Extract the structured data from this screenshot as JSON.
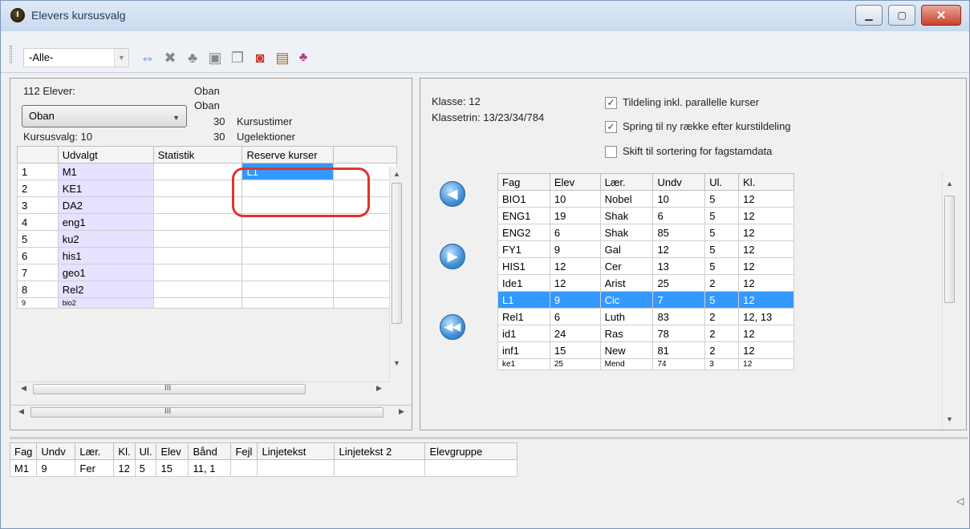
{
  "window": {
    "title": "Elevers kursusvalg",
    "minimize": "▁",
    "maximize": "▢",
    "close": "✕"
  },
  "toolbar": {
    "filter_value": "-Alle-",
    "icons": [
      "swap-icon",
      "delete-icon",
      "hierarchy-icon",
      "lock-icon",
      "copy-icon",
      "magnify-remove-icon",
      "multi-copy-icon",
      "users-icon"
    ]
  },
  "left_panel": {
    "student_count": "112 Elever:",
    "class_name_1": "Oban",
    "class_name_2": "Oban",
    "student_select": "Oban",
    "hours_value": "30",
    "hours_label": "Kursustimer",
    "lessons_value": "30",
    "lessons_label": "Ugelektioner",
    "course_choice": "Kursusvalg: 10",
    "columns": [
      "",
      "Udvalgt",
      "Statistik",
      "Reserve kurser"
    ],
    "rows": [
      {
        "n": "1",
        "udvalgt": "M1",
        "statistik": "",
        "reserve": "L1"
      },
      {
        "n": "2",
        "udvalgt": "KE1",
        "statistik": "",
        "reserve": ""
      },
      {
        "n": "3",
        "udvalgt": "DA2",
        "statistik": "",
        "reserve": ""
      },
      {
        "n": "4",
        "udvalgt": "eng1",
        "statistik": "",
        "reserve": ""
      },
      {
        "n": "5",
        "udvalgt": "ku2",
        "statistik": "",
        "reserve": ""
      },
      {
        "n": "6",
        "udvalgt": "his1",
        "statistik": "",
        "reserve": ""
      },
      {
        "n": "7",
        "udvalgt": "geo1",
        "statistik": "",
        "reserve": ""
      },
      {
        "n": "8",
        "udvalgt": "Rel2",
        "statistik": "",
        "reserve": ""
      },
      {
        "n": "9",
        "udvalgt": "bio2",
        "statistik": "",
        "reserve": ""
      }
    ],
    "hscroll_marker": "III"
  },
  "right_panel": {
    "class_label": "Klasse: 12",
    "class_level": "Klassetrin: 13/23/34/784",
    "options": [
      {
        "label": "Tildeling inkl. parallelle kurser",
        "checked": true
      },
      {
        "label": "Spring til ny række efter kurstildeling",
        "checked": true
      },
      {
        "label": "Skift til sortering for fagstamdata",
        "checked": false
      }
    ],
    "columns": [
      "Fag",
      "Elev",
      "Lær.",
      "Undv",
      "Ul.",
      "Kl."
    ],
    "rows": [
      [
        "BIO1",
        "10",
        "Nobel",
        "10",
        "5",
        "12"
      ],
      [
        "ENG1",
        "19",
        "Shak",
        "6",
        "5",
        "12"
      ],
      [
        "ENG2",
        "6",
        "Shak",
        "85",
        "5",
        "12"
      ],
      [
        "FY1",
        "9",
        "Gal",
        "12",
        "5",
        "12"
      ],
      [
        "HIS1",
        "12",
        "Cer",
        "13",
        "5",
        "12"
      ],
      [
        "Ide1",
        "12",
        "Arist",
        "25",
        "2",
        "12"
      ],
      [
        "L1",
        "9",
        "Cic",
        "7",
        "5",
        "12"
      ],
      [
        "Rel1",
        "6",
        "Luth",
        "83",
        "2",
        "12, 13"
      ],
      [
        "id1",
        "24",
        "Ras",
        "78",
        "2",
        "12"
      ],
      [
        "inf1",
        "15",
        "New",
        "81",
        "2",
        "12"
      ],
      [
        "ke1",
        "25",
        "Mend",
        "74",
        "3",
        "12"
      ]
    ],
    "selected_row": 6
  },
  "bottom_panel": {
    "columns": [
      "Fag",
      "Undv",
      "Lær.",
      "Kl.",
      "Ul.",
      "Elev",
      "Bånd",
      "Fejl",
      "Linjetekst",
      "Linjetekst 2",
      "Elevgruppe"
    ],
    "row": [
      "M1",
      "9",
      "Fer",
      "12",
      "5",
      "15",
      "11, 1",
      "",
      "",
      "",
      ""
    ]
  }
}
